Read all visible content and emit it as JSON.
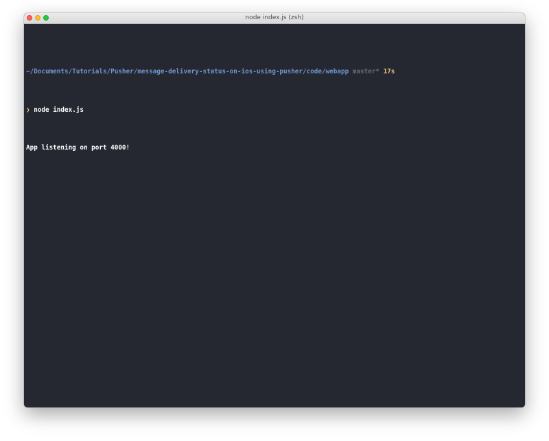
{
  "window": {
    "title": "node index.js (zsh)"
  },
  "terminal": {
    "cwd": "~/Documents/Tutorials/Pusher/message-delivery-status-on-ios-using-pusher/code/webapp",
    "git_branch": "master*",
    "elapsed": "17s",
    "prompt_symbol": "❯",
    "command": "node index.js",
    "output": "App listening on port 4000!"
  },
  "colors": {
    "background": "#252731",
    "path": "#6f96ce",
    "branch": "#6d6d6d",
    "elapsed": "#e6c07b",
    "text": "#ffffff"
  }
}
